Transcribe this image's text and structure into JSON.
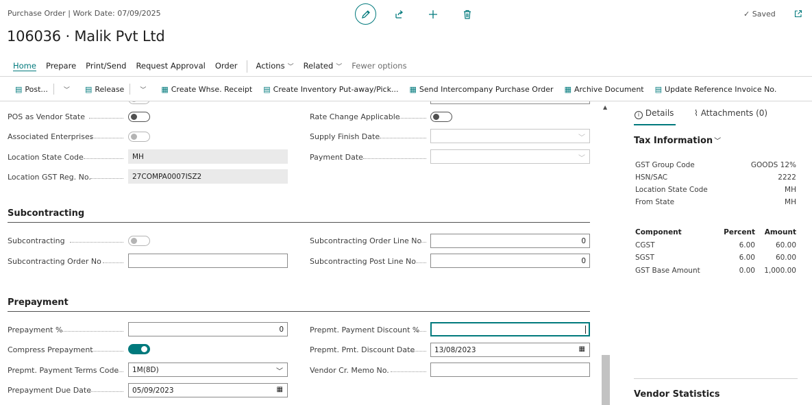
{
  "header": {
    "breadcrumb": "Purchase Order | Work Date: 07/09/2025",
    "title": "106036 · Malik Pvt Ltd",
    "saved_label": "Saved",
    "icons": [
      "pencil-icon",
      "share-icon",
      "plus-icon",
      "trash-icon",
      "check-icon",
      "popout-icon"
    ]
  },
  "nav": {
    "home": "Home",
    "prepare": "Prepare",
    "print_send": "Print/Send",
    "request_approval": "Request Approval",
    "order": "Order",
    "actions": "Actions",
    "related": "Related",
    "fewer_options": "Fewer options"
  },
  "actions": {
    "post": "Post...",
    "release": "Release",
    "create_whse_receipt": "Create Whse. Receipt",
    "create_inventory_putaway": "Create Inventory Put-away/Pick...",
    "send_intercompany": "Send Intercompany Purchase Order",
    "archive_document": "Archive Document",
    "update_reference_invoice": "Update Reference Invoice No."
  },
  "form": {
    "pos_vendor_state": {
      "label": "POS as Vendor State",
      "on": false
    },
    "associated_enterprises": {
      "label": "Associated Enterprises",
      "on": false,
      "disabled": true
    },
    "location_state_code": {
      "label": "Location State Code",
      "value": "MH"
    },
    "location_gst_reg_no": {
      "label": "Location GST Reg. No.",
      "value": "27COMPA0007ISZ2"
    },
    "rate_change_applicable": {
      "label": "Rate Change Applicable",
      "on": false
    },
    "supply_finish_date": {
      "label": "Supply Finish Date",
      "value": ""
    },
    "payment_date": {
      "label": "Payment Date",
      "value": ""
    }
  },
  "subcontracting": {
    "title": "Subcontracting",
    "subcontracting": {
      "label": "Subcontracting",
      "on": false,
      "disabled": true
    },
    "order_no": {
      "label": "Subcontracting Order No",
      "value": ""
    },
    "order_line_no": {
      "label": "Subcontracting Order Line No",
      "value": "0"
    },
    "post_line_no": {
      "label": "Subcontracting Post Line No",
      "value": "0"
    }
  },
  "prepayment": {
    "title": "Prepayment",
    "prepayment_pct": {
      "label": "Prepayment %",
      "value": "0"
    },
    "compress": {
      "label": "Compress Prepayment",
      "on": true
    },
    "terms_code": {
      "label": "Prepmt. Payment Terms Code",
      "value": "1M(8D)"
    },
    "due_date": {
      "label": "Prepayment Due Date",
      "value": "05/09/2023"
    },
    "discount_pct": {
      "label": "Prepmt. Payment Discount %",
      "value": ""
    },
    "discount_date": {
      "label": "Prepmt. Pmt. Discount Date",
      "value": "13/08/2023"
    },
    "vendor_cr_memo": {
      "label": "Vendor Cr. Memo No.",
      "value": ""
    }
  },
  "factbox": {
    "tab_details": "Details",
    "tab_attachments": "Attachments (0)",
    "tax_title": "Tax Information",
    "rows": [
      {
        "label": "GST Group Code",
        "value": "GOODS 12%"
      },
      {
        "label": "HSN/SAC",
        "value": "2222"
      },
      {
        "label": "Location State Code",
        "value": "MH"
      },
      {
        "label": "From State",
        "value": "MH"
      }
    ],
    "table_headers": {
      "component": "Component",
      "percent": "Percent",
      "amount": "Amount"
    },
    "table_rows": [
      {
        "component": "CGST",
        "percent": "6.00",
        "amount": "60.00"
      },
      {
        "component": "SGST",
        "percent": "6.00",
        "amount": "60.00"
      },
      {
        "component": "GST Base Amount",
        "percent": "0.00",
        "amount": "1,000.00"
      }
    ],
    "vendor_statistics": "Vendor Statistics"
  },
  "colors": {
    "accent": "#00797c"
  }
}
